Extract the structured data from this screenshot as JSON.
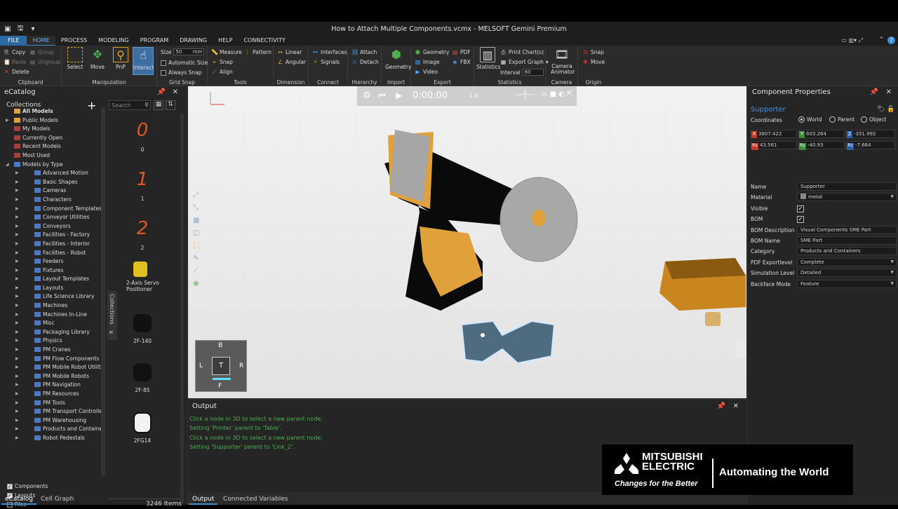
{
  "window": {
    "title": "How to Attach Multiple Components.vcmx - MELSOFT Gemini Premium"
  },
  "menu": {
    "file": "FILE",
    "home": "HOME",
    "process": "PROCESS",
    "modeling": "MODELING",
    "program": "PROGRAM",
    "drawing": "DRAWING",
    "help": "HELP",
    "connectivity": "CONNECTIVITY"
  },
  "ribbon": {
    "clipboard": {
      "label": "Clipboard",
      "copy": "Copy",
      "paste": "Paste",
      "delete": "Delete",
      "group": "Group",
      "ungroup": "Ungroup"
    },
    "manipulation": {
      "label": "Manipulation",
      "select": "Select",
      "move": "Move",
      "pnp": "PnP",
      "interact": "Interact"
    },
    "grid_snap": {
      "label": "Grid Snap",
      "size": "Size",
      "size_value": "50",
      "size_unit": "mm",
      "automatic_size": "Automatic Size",
      "always_snap": "Always Snap"
    },
    "tools": {
      "label": "Tools",
      "measure": "Measure",
      "pattern": "Pattern",
      "snap": "Snap",
      "align": "Align"
    },
    "dimension": {
      "label": "Dimension",
      "linear": "Linear",
      "angular": "Angular"
    },
    "connect": {
      "label": "Connect",
      "interfaces": "Interfaces",
      "signals": "Signals"
    },
    "hierarchy": {
      "label": "Hierarchy",
      "attach": "Attach",
      "detach": "Detach"
    },
    "import": {
      "label": "Import",
      "geometry": "Geometry"
    },
    "export": {
      "label": "Export",
      "geometry": "Geometry",
      "pdf": "PDF",
      "image": "Image",
      "fbx": "FBX",
      "video": "Video"
    },
    "statistics": {
      "label": "Statistics",
      "statistics": "Statistics",
      "print_charts": "Print Chart(s)",
      "export_graph": "Export Graph",
      "interval": "Interval",
      "interval_value": "60"
    },
    "camera": {
      "label": "Camera",
      "camera_animator": "Camera Animator"
    },
    "origin": {
      "label": "Origin",
      "snap": "Snap",
      "move": "Move"
    }
  },
  "ecatalog": {
    "title": "eCatalog",
    "collections": "Collections",
    "search_placeholder": "Search",
    "items_count": "3246 Items",
    "side_tab": "Collections",
    "tree": [
      "All Models",
      "Public Models",
      "My Models",
      "Currently Open",
      "Recent Models",
      "Most Used",
      "Models by Type",
      "Advanced Motion",
      "Basic Shapes",
      "Cameras",
      "Characters",
      "Component Templates",
      "Conveyor Utilities",
      "Conveyors",
      "Facilities - Factory",
      "Facilities - Interior",
      "Facilities - Robot",
      "Feeders",
      "Fixtures",
      "Layout Templates",
      "Layouts",
      "Life Science Library",
      "Machines",
      "Machines In-Line",
      "Misc",
      "Packaging Library",
      "Physics",
      "PM Cranes",
      "PM Flow Components",
      "PM Mobile Robot Utilitie",
      "PM Mobile Robots",
      "PM Navigation",
      "PM Resources",
      "PM Tools",
      "PM Transport Controllers",
      "PM Warehousing",
      "Products and Containers",
      "Robot Pedestals"
    ],
    "filters": [
      "Components",
      "Layouts",
      "Files"
    ],
    "thumbs": [
      "0",
      "1",
      "2",
      "2-Axis Servo Positioner",
      "2F-140",
      "2F-85",
      "2FG14"
    ]
  },
  "viewport": {
    "time": "0:00:00",
    "speed": "1.0",
    "nav": {
      "top": "B",
      "left": "L",
      "center": "T",
      "right": "R",
      "bottom": "F"
    }
  },
  "props": {
    "title": "Component Properties",
    "component": "Supporter",
    "coordinates": "Coordinates",
    "coord_options": [
      "World",
      "Parent",
      "Object"
    ],
    "x": "3807.422",
    "y": "603.264",
    "z": "-351.992",
    "rx": "43.561",
    "ry": "-40.93",
    "rz": "-7.664",
    "rows": [
      {
        "k": "Name",
        "v": "Supporter"
      },
      {
        "k": "Material",
        "v": "metal"
      },
      {
        "k": "Visible",
        "v": ""
      },
      {
        "k": "BOM",
        "v": ""
      },
      {
        "k": "BOM Description",
        "v": "Visual Components SME Part"
      },
      {
        "k": "BOM Name",
        "v": "SME Part"
      },
      {
        "k": "Category",
        "v": "Products and Containers"
      },
      {
        "k": "PDF Exportlevel",
        "v": "Complete"
      },
      {
        "k": "Simulation Level",
        "v": "Detailed"
      },
      {
        "k": "Backface Mode",
        "v": "Feature"
      }
    ]
  },
  "output": {
    "title": "Output",
    "lines": [
      "Click a node in 3D to select a new parent node.",
      "Setting 'Printer' parent to 'Table'.",
      "Click a node in 3D to select a new parent node.",
      "Setting 'Supporter' parent to 'Link_2'."
    ]
  },
  "tabs": {
    "ecatalog": "eCatalog",
    "cell_graph": "Cell Graph",
    "output": "Output",
    "connected_variables": "Connected Variables"
  },
  "brand": {
    "name1": "MITSUBISHI",
    "name2": "ELECTRIC",
    "tagline": "Changes for the Better",
    "slogan": "Automating the World"
  }
}
